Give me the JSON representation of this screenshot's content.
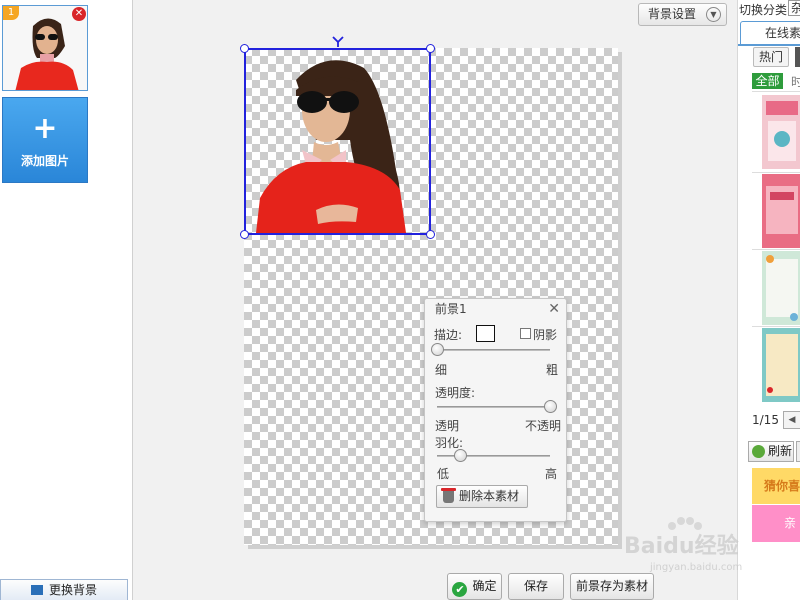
{
  "left_panel": {
    "thumbnail_badge": "1",
    "add_image_label": "添加图片",
    "change_background_label": "更换背景"
  },
  "toolbar": {
    "background_settings_label": "背景设置"
  },
  "foreground_dialog": {
    "title": "前景1",
    "stroke_label": "描边:",
    "shadow_label": "阴影",
    "shadow_checked": false,
    "stroke_thin": "细",
    "stroke_thick": "粗",
    "stroke_value": 0.0,
    "opacity_label": "透明度:",
    "opacity_min": "透明",
    "opacity_max": "不透明",
    "opacity_value": 1.0,
    "feather_label": "羽化:",
    "feather_min": "低",
    "feather_max": "高",
    "feather_value": 0.2,
    "delete_label": "删除本素材"
  },
  "bottom_buttons": {
    "confirm": "确定",
    "save": "保存",
    "save_foreground": "前景存为素材"
  },
  "right_panel": {
    "category_label": "切换分类",
    "category_value": "杂",
    "tab_online": "在线素材",
    "chip_hot": "热门",
    "filter_all": "全部",
    "filter_next": "时",
    "pagination": "1/15",
    "refresh_label": "刷新",
    "banner_guess": "猜你喜",
    "banner_pink": "亲"
  },
  "watermark": {
    "brand": "Baidu经验",
    "url": "jingyan.baidu.com"
  },
  "colors": {
    "accent_blue": "#2222dd",
    "add_button": "#3796e4",
    "confirm_green": "#2aa640",
    "filter_green": "#2e9c3c"
  }
}
